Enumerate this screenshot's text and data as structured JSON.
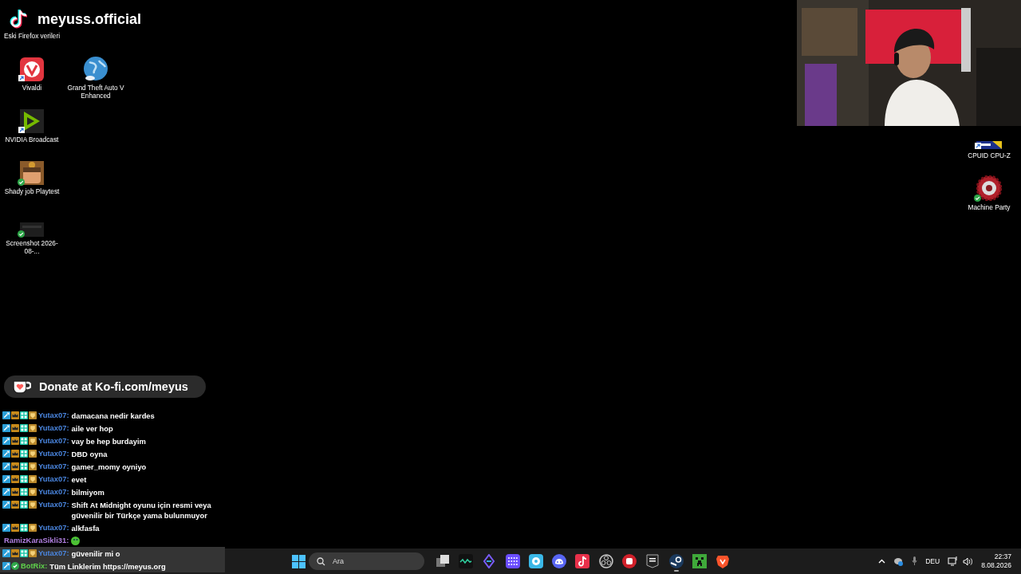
{
  "overlay": {
    "handle": "meyuss.official",
    "donate": "Donate at Ko-fi.com/meyus"
  },
  "desktop": {
    "left_columns": [
      [
        {
          "label": "Eski Firefox verileri",
          "kind": "covered",
          "shortcut": false,
          "synced": false
        },
        {
          "label": "Vivaldi",
          "kind": "vivaldi",
          "shortcut": true,
          "synced": false
        },
        {
          "label": "NVIDIA Broadcast",
          "kind": "broadcast",
          "shortcut": true,
          "synced": false
        },
        {
          "label": "Shady job Playtest",
          "kind": "game",
          "shortcut": false,
          "synced": true
        },
        {
          "label": "Screenshot 2026-08-...",
          "kind": "screenshot",
          "shortcut": false,
          "synced": true
        }
      ],
      [
        {
          "label": "Grand Theft Auto V Enhanced",
          "kind": "globe",
          "shortcut": false,
          "synced": false
        }
      ]
    ],
    "right_column": [
      {
        "label": "CPUID CPU-Z",
        "kind": "cpuz",
        "shortcut": true,
        "synced": false
      },
      {
        "label": "Machine Party",
        "kind": "gear",
        "shortcut": false,
        "synced": true
      }
    ]
  },
  "chat": [
    {
      "kind": "subscriber",
      "user": "Yutax07:",
      "color": "#4a86e0",
      "text": "damacana nedir kardes",
      "highlighted": false
    },
    {
      "kind": "subscriber",
      "user": "Yutax07:",
      "color": "#4a86e0",
      "text": "aile ver hop",
      "highlighted": false
    },
    {
      "kind": "subscriber",
      "user": "Yutax07:",
      "color": "#4a86e0",
      "text": "vay be hep burdayim",
      "highlighted": false
    },
    {
      "kind": "subscriber",
      "user": "Yutax07:",
      "color": "#4a86e0",
      "text": "DBD oyna",
      "highlighted": false
    },
    {
      "kind": "subscriber",
      "user": "Yutax07:",
      "color": "#4a86e0",
      "text": "gamer_momy oyniyo",
      "highlighted": false
    },
    {
      "kind": "subscriber",
      "user": "Yutax07:",
      "color": "#4a86e0",
      "text": "evet",
      "highlighted": false
    },
    {
      "kind": "subscriber",
      "user": "Yutax07:",
      "color": "#4a86e0",
      "text": "bilmiyom",
      "highlighted": false
    },
    {
      "kind": "subscriber",
      "user": "Yutax07:",
      "color": "#4a86e0",
      "text": "Shift At Midnight oyunu için resmi veya güvenilir bir Türkçe yama bulunmuyor",
      "highlighted": false
    },
    {
      "kind": "subscriber",
      "user": "Yutax07:",
      "color": "#4a86e0",
      "text": "alkfasfa",
      "highlighted": false
    },
    {
      "kind": "plain",
      "user": "RamizKaraSikli31:",
      "color": "#b07fe0",
      "emote": true,
      "highlighted": false
    },
    {
      "kind": "subscriber",
      "user": "Yutax07:",
      "color": "#4a86e0",
      "text": "güvenilir mi o",
      "highlighted": true
    },
    {
      "kind": "bot",
      "user": "BotRix:",
      "color": "#5fd14b",
      "text": "Tüm Linklerim https://meyus.org",
      "highlighted": true
    }
  ],
  "taskbar": {
    "search": {
      "placeholder": "Ara"
    },
    "apps": [
      {
        "kind": "taskview",
        "running": false
      },
      {
        "kind": "wave",
        "running": false
      },
      {
        "kind": "diamond",
        "running": false
      },
      {
        "kind": "grid",
        "running": false
      },
      {
        "kind": "disc",
        "running": false
      },
      {
        "kind": "discord",
        "running": false
      },
      {
        "kind": "tiktok",
        "running": false
      },
      {
        "kind": "obs",
        "running": false
      },
      {
        "kind": "fist",
        "running": false
      },
      {
        "kind": "epic",
        "running": false
      },
      {
        "kind": "steam",
        "running": true
      },
      {
        "kind": "creeper",
        "running": false
      },
      {
        "kind": "brave",
        "running": false
      }
    ],
    "language": "DEU",
    "time": "22:37",
    "date": "8.08.2026"
  }
}
